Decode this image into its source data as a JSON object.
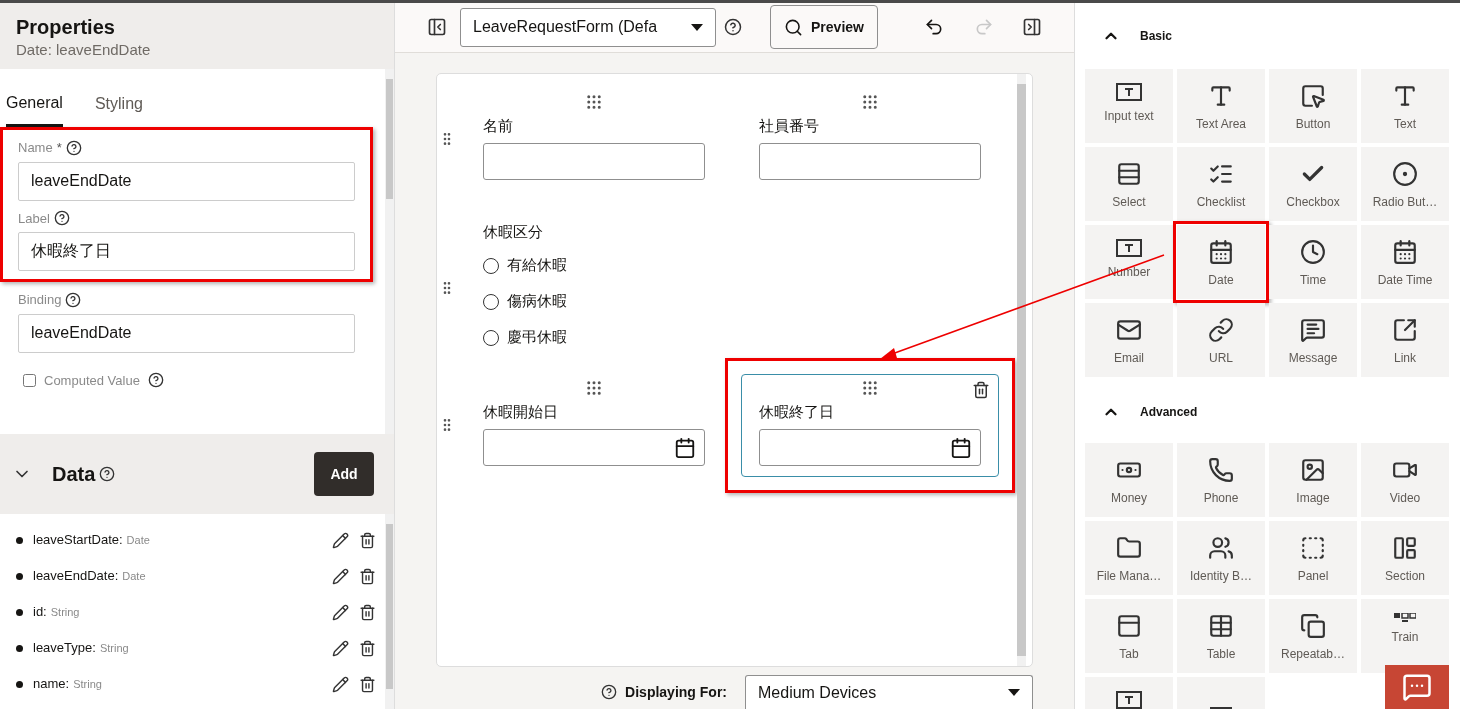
{
  "properties": {
    "title": "Properties",
    "subtitle": "Date: leaveEndDate",
    "tabs": [
      {
        "label": "General",
        "selected": true
      },
      {
        "label": "Styling",
        "selected": false
      }
    ],
    "fields": [
      {
        "label": "Name",
        "required": true,
        "value": "leaveEndDate",
        "highlight": true
      },
      {
        "label": "Label",
        "required": false,
        "value": "休暇終了日",
        "highlight": true
      },
      {
        "label": "Binding",
        "required": false,
        "value": "leaveEndDate",
        "highlight": false
      }
    ],
    "required_mark": "*",
    "computed": {
      "label": "Computed Value",
      "checked": false
    }
  },
  "data": {
    "title": "Data",
    "expanded": true,
    "add": "Add",
    "items": [
      {
        "name": "leaveStartDate:",
        "type": "Date"
      },
      {
        "name": "leaveEndDate:",
        "type": "Date"
      },
      {
        "name": "id:",
        "type": "String"
      },
      {
        "name": "leaveType:",
        "type": "String"
      },
      {
        "name": "name:",
        "type": "String"
      }
    ]
  },
  "toolbar": {
    "form_select": "LeaveRequestForm (Defa",
    "preview": "Preview",
    "redo_disabled": true
  },
  "canvas": {
    "rows": [
      {
        "kind": "fields",
        "items": [
          {
            "label": "名前",
            "kind": "text",
            "selected": false
          },
          {
            "label": "社員番号",
            "kind": "text",
            "selected": false
          }
        ]
      },
      {
        "kind": "radio",
        "label": "休暇区分",
        "options": [
          {
            "label": "有給休暇",
            "selected": false
          },
          {
            "label": "傷病休暇",
            "selected": false
          },
          {
            "label": "慶弔休暇",
            "selected": false
          }
        ]
      },
      {
        "kind": "fields",
        "items": [
          {
            "label": "休暇開始日",
            "kind": "date",
            "selected": false
          },
          {
            "label": "休暇終了日",
            "kind": "date",
            "selected": true,
            "highlight": true
          }
        ]
      }
    ]
  },
  "displaying": {
    "label": "Displaying For:",
    "value": "Medium Devices"
  },
  "palette": {
    "sections": [
      {
        "title": "Basic",
        "expanded": true,
        "items": [
          {
            "label": "Input text"
          },
          {
            "label": "Text Area"
          },
          {
            "label": "Button"
          },
          {
            "label": "Text"
          },
          {
            "label": "Select"
          },
          {
            "label": "Checklist"
          },
          {
            "label": "Checkbox"
          },
          {
            "label": "Radio But…"
          },
          {
            "label": "Number"
          },
          {
            "label": "Date",
            "highlight": true
          },
          {
            "label": "Time"
          },
          {
            "label": "Date Time"
          },
          {
            "label": "Email"
          },
          {
            "label": "URL"
          },
          {
            "label": "Message"
          },
          {
            "label": "Link"
          }
        ]
      },
      {
        "title": "Advanced",
        "expanded": true,
        "items": [
          {
            "label": "Money"
          },
          {
            "label": "Phone"
          },
          {
            "label": "Image"
          },
          {
            "label": "Video"
          },
          {
            "label": "File Mana…"
          },
          {
            "label": "Identity B…"
          },
          {
            "label": "Panel"
          },
          {
            "label": "Section"
          },
          {
            "label": "Tab"
          },
          {
            "label": "Table"
          },
          {
            "label": "Repeatab…"
          },
          {
            "label": "Train"
          },
          {
            "cut": true
          },
          {
            "cut": true
          }
        ]
      }
    ]
  }
}
